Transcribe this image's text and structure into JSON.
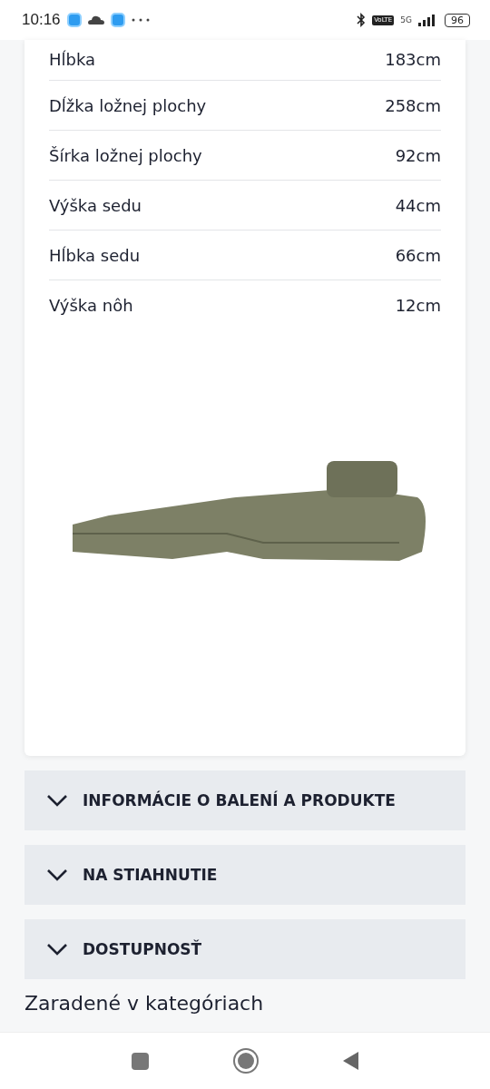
{
  "status_bar": {
    "time": "10:16",
    "volte": "VoLTE",
    "network": "5G",
    "battery": "96"
  },
  "specs": [
    {
      "label": "Hĺbka",
      "value": "183cm"
    },
    {
      "label": "Dĺžka ložnej plochy",
      "value": "258cm"
    },
    {
      "label": "Šírka ložnej plochy",
      "value": "92cm"
    },
    {
      "label": "Výška sedu",
      "value": "44cm"
    },
    {
      "label": "Hĺbka sedu",
      "value": "66cm"
    },
    {
      "label": "Výška nôh",
      "value": "12cm"
    }
  ],
  "accordions": [
    {
      "title": "INFORMÁCIE O BALENÍ A PRODUKTE",
      "expanded": false
    },
    {
      "title": "NA STIAHNUTIE",
      "expanded": false
    },
    {
      "title": "DOSTUPNOSŤ",
      "expanded": false
    }
  ],
  "categories_heading": "Zaradené v kategóriach"
}
